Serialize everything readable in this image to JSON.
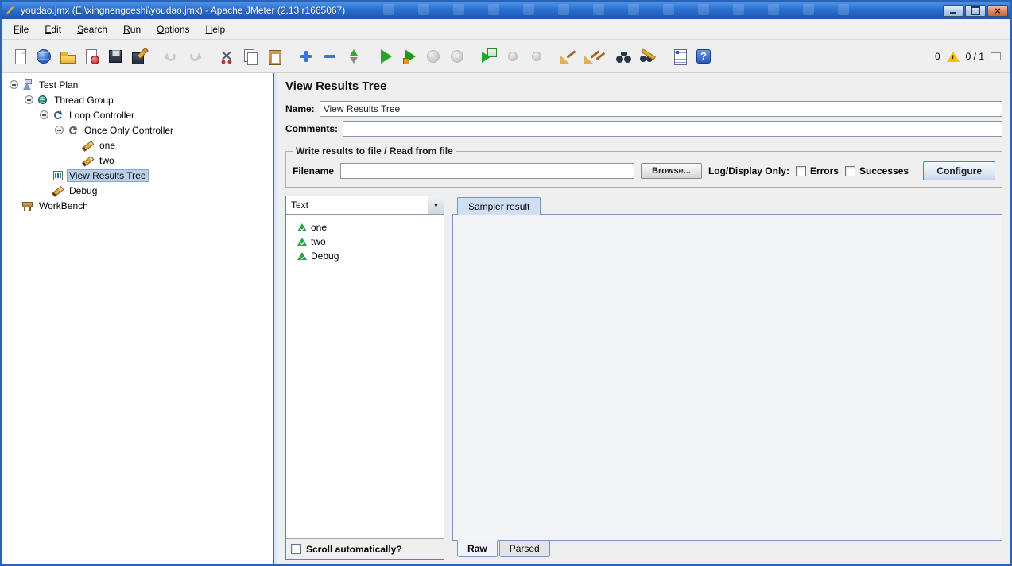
{
  "window": {
    "title": "youdao.jmx (E:\\xingnengceshi\\youdao.jmx) - Apache JMeter (2.13 r1665067)"
  },
  "menubar": {
    "items": [
      {
        "label": "File"
      },
      {
        "label": "Edit"
      },
      {
        "label": "Search"
      },
      {
        "label": "Run"
      },
      {
        "label": "Options"
      },
      {
        "label": "Help"
      }
    ]
  },
  "toolbar": {
    "icons": [
      {
        "name": "new-file",
        "enabled": true
      },
      {
        "name": "templates",
        "enabled": true
      },
      {
        "name": "open-file",
        "enabled": true
      },
      {
        "name": "close-file",
        "enabled": true
      },
      {
        "name": "save",
        "enabled": true
      },
      {
        "name": "save-as",
        "enabled": true
      },
      {
        "name": "undo",
        "enabled": false
      },
      {
        "name": "redo",
        "enabled": false
      },
      {
        "name": "cut",
        "enabled": true
      },
      {
        "name": "copy",
        "enabled": true
      },
      {
        "name": "paste",
        "enabled": true
      },
      {
        "name": "expand-all",
        "enabled": true
      },
      {
        "name": "collapse-all",
        "enabled": true
      },
      {
        "name": "toggle",
        "enabled": true
      },
      {
        "name": "start",
        "enabled": true
      },
      {
        "name": "start-no-pauses",
        "enabled": true
      },
      {
        "name": "stop",
        "enabled": false
      },
      {
        "name": "shutdown",
        "enabled": false
      },
      {
        "name": "remote-start-all",
        "enabled": true
      },
      {
        "name": "remote-stop-all",
        "enabled": false
      },
      {
        "name": "remote-shutdown-all",
        "enabled": false
      },
      {
        "name": "clear",
        "enabled": true
      },
      {
        "name": "clear-all",
        "enabled": true
      },
      {
        "name": "search",
        "enabled": true
      },
      {
        "name": "search-reset",
        "enabled": true
      },
      {
        "name": "function-helper",
        "enabled": true
      },
      {
        "name": "help",
        "enabled": true
      }
    ],
    "warning_count": "0",
    "thread_counter": "0 / 1"
  },
  "tree": {
    "items": [
      {
        "label": "Test Plan",
        "icon": "test-plan",
        "depth": 0,
        "expanded": true
      },
      {
        "label": "Thread Group",
        "icon": "thread-group",
        "depth": 1,
        "expanded": true
      },
      {
        "label": "Loop Controller",
        "icon": "loop-controller",
        "depth": 2,
        "expanded": true
      },
      {
        "label": "Once Only Controller",
        "icon": "once-only-controller",
        "depth": 3,
        "expanded": true
      },
      {
        "label": "one",
        "icon": "sampler-pencil",
        "depth": 4
      },
      {
        "label": "two",
        "icon": "sampler-pencil",
        "depth": 4
      },
      {
        "label": "View Results Tree",
        "icon": "view-results-tree",
        "depth": 2,
        "selected": true
      },
      {
        "label": "Debug",
        "icon": "sampler-pencil",
        "depth": 2
      },
      {
        "label": "WorkBench",
        "icon": "workbench",
        "depth": 0
      }
    ]
  },
  "main": {
    "title": "View Results Tree",
    "name": {
      "label": "Name:",
      "value": "View Results Tree"
    },
    "comments": {
      "label": "Comments:",
      "value": ""
    },
    "file_group": {
      "legend": "Write results to file / Read from file",
      "filename_label": "Filename",
      "filename_value": "",
      "browse_button": "Browse...",
      "log_display_label": "Log/Display Only:",
      "errors_label": "Errors",
      "successes_label": "Successes",
      "configure_button": "Configure"
    },
    "results_tree": {
      "view_mode": "Text",
      "items": [
        {
          "label": "one",
          "status": "success"
        },
        {
          "label": "two",
          "status": "success"
        },
        {
          "label": "Debug",
          "status": "success"
        }
      ],
      "scroll_label": "Scroll automatically?"
    },
    "result_tabs": {
      "top_tab": "Sampler result",
      "bottom_tabs": [
        {
          "label": "Raw",
          "selected": true
        },
        {
          "label": "Parsed",
          "selected": false
        }
      ]
    }
  },
  "colors": {
    "titlebar_blue": "#2a6fd0",
    "selection_blue": "#b8d0ea",
    "tab_selected": "#cfe0f2",
    "warning_yellow": "#f2c400",
    "start_green": "#22a822"
  }
}
